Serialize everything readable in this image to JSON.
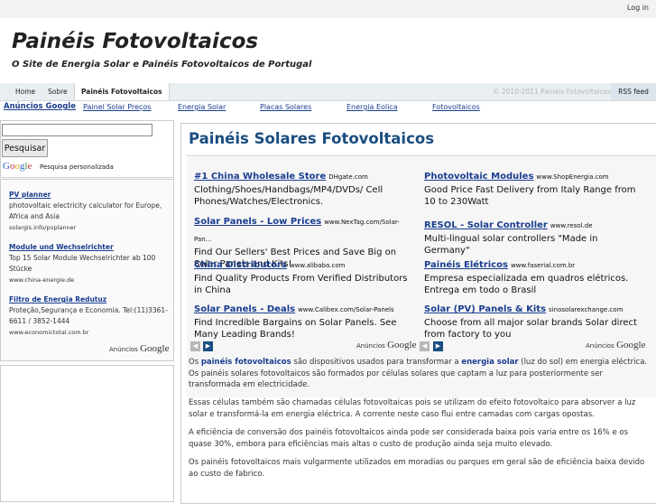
{
  "topbar": {
    "login": "Log in"
  },
  "header": {
    "title": "Painéis Fotovoltaicos",
    "tagline": "O Site de Energia Solar e Painéis Fotovoltaicos de Portugal"
  },
  "nav": {
    "items": [
      "Home",
      "Sobre",
      "Painéis Fotovoltaicos"
    ],
    "copyright": "© 2010-2011 Painéis Fotovoltaicos",
    "rss": "RSS feed"
  },
  "adlinks": {
    "label": "Anúncios Google",
    "links": [
      "Painel Solar Preços",
      "Energia Solar",
      "Placas Solares",
      "Energia Eolica",
      "Fotovoltaicos"
    ]
  },
  "search": {
    "button": "Pesquisar",
    "google": "Google",
    "personalizada": "Pesquisa personalizada"
  },
  "sidebar_ads": [
    {
      "title": "PV planner",
      "desc": "photovoltaic electricity calculator for Europe, Africa and Asia",
      "url": "solargis.info/pvplanner"
    },
    {
      "title": "Module und Wechselrichter",
      "desc": "Top 15 Solar Module Wechselrichter ab 100 Stücke",
      "url": "www.china-energie.de"
    },
    {
      "title": "Filtro de Energia Redutuz",
      "desc": "Proteção,Segurança e Economia. Tel:(11)3361-6611 / 3852-1444",
      "url": "www.economictotal.com.br"
    }
  ],
  "anuncios_label": "Anúncios",
  "anuncios_google": "Google",
  "main": {
    "title": "Painéis Solares Fotovoltaicos",
    "ads": [
      {
        "title": "#1 China Wholesale Store",
        "url": "DHgate.com",
        "desc": "Clothing/Shoes/Handbags/MP4/DVDs/ Cell Phones/Watches/Electronics."
      },
      {
        "title": "Photovoltaic Modules",
        "url": "www.ShopEnergia.com",
        "desc": "Good Price Fast Delivery from Italy Range from 10 to 230Watt"
      },
      {
        "title": "Solar Panels - Low Prices",
        "url": "www.NexTag.com/Solar-Pan...",
        "desc": "Find Our Sellers' Best Prices and Save Big on Solar Panels and Kits!"
      },
      {
        "title": "RESOL - Solar Controller",
        "url": "www.resol.de",
        "desc": "Multi-lingual solar controllers \"Made in Germany\""
      },
      {
        "title": "China Distributors",
        "url": "www.alibaba.com",
        "desc": "Find Quality Products From Verified Distributors in China"
      },
      {
        "title": "Painéis Elétricos",
        "url": "www.faserial.com.br",
        "desc": "Empresa especializada em quadros elétricos. Entrega em todo o Brasil"
      },
      {
        "title": "Solar Panels - Deals",
        "url": "www.Calibex.com/Solar-Panels",
        "desc": "Find Incredible Bargains on Solar Panels. See Many Leading Brands!"
      },
      {
        "title": "Solar (PV) Panels & Kits",
        "url": "sinosolarexchange.com",
        "desc": "Choose from all major solar brands Solar direct from factory to you"
      }
    ],
    "p1": {
      "a": "Os ",
      "b": "painéis fotovoltaicos",
      "c": " são dispositivos usados para transformar a ",
      "d": "energia solar",
      "e": " (luz do sol) em energia eléctrica. Os painéis solares fotovoltaicos são formados por células solares que captam a luz para posteriormente ser transformada em electricidade."
    },
    "p2": "Essas células também são chamadas células fotovoltaicas pois se utilizam do efeito fotovoltaico para absorver a luz solar e transformá-la em energia eléctrica. A corrente neste caso flui entre camadas com cargas opostas.",
    "p3": "A eficiência de conversão dos painéis fotovoltaicos ainda pode ser considerada baixa pois varia entre os 16% e os quase 30%, embora para eficiências mais altas o custo de produção ainda seja muito elevado.",
    "p4": "Os painéis fotovoltaicos mais vulgarmente utilizados em moradias ou parques em geral são de eficiência baixa devido ao custo de fabrico."
  }
}
